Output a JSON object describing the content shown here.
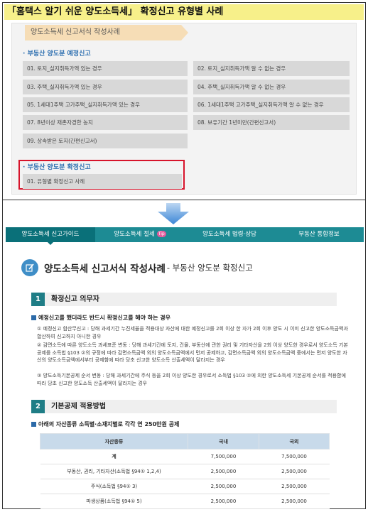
{
  "title": "「홈택스 알기 쉬운 양도소득세」 확정신고 유형별 사례",
  "top_panel": {
    "ribbon": "양도소득세 신고서식 작성사례",
    "section1_label": "부동산 양도분 예정신고",
    "items": [
      "01. 토지_실지취득가액 있는 경우",
      "02. 토지_실지취득가액 알 수 없는 경우",
      "03. 주택_실지취득가액 있는 경우",
      "04. 주택_실지취득가액 알 수 없는 경우",
      "05. 1세대1주택 고가주택_실지취득가액 있는 경우",
      "06. 1세대1주택 고가주택_실지취득가액 알 수 없는 경우",
      "07. 8년이상 재촌자경한 농지",
      "08. 보유기간 1년미만(간편신고서)",
      "09. 상속받은 토지(간편신고서)"
    ],
    "section2_label": "부동산 양도분 확정신고",
    "highlight_item": "01. 유형별 확정신고 사례"
  },
  "nav": {
    "items": [
      "양도소득세 신고가이드",
      "양도소득세 절세",
      "양도소득세 법령·상담",
      "부동산 통합정보"
    ],
    "tip_badge": "Tip"
  },
  "page": {
    "title": "양도소득세 신고서식 작성사례",
    "subtitle": "- 부동산 양도분 확정신고"
  },
  "step1": {
    "number": "1",
    "label": "확정신고 의무자",
    "bullet": "예정신고를 했더라도 반드시 확정신고를 해야 하는 경우",
    "para1": "① 예정신고 합산무신고 : 당해 과세기간 누진세율을 적용대상 자산에 대한 예정신고를 2회 이상 한 자가 2회 이후 양도 시 이미 신고한 양도소득금액과 합산하여 신고하지 아니한 경우",
    "para2": "② 감면소득에 따른 양도소득 과세표준 변동 : 당해 과세기간에 토지, 건물, 부동산에 관한 권리 및 기타자산을 2회 이상 양도한 경우로서 양도소득 기본공제를 소득법 §103 ②의 규정에 따라 감면소득금액 외의 양도소득금액에서 먼저 공제하고, 감면소득금액 외의 양도소득금액 중에서는 먼저 양도한 자산의 양도소득금액에서부터 공제함에 따라 당초 신고한 양도소득 산출세액이 달라지는 경우",
    "para3": "③ 양도소득기본공제 순서 변동 : 당해 과세기간에 주식 등을 2회 이상 양도한 경우로서 소득법 §103 ②에 의한 양도소득세 기본공제 순서를 적용함에 따라 당초 신고한 양도소득 산출세액이 달라지는 경우"
  },
  "step2": {
    "number": "2",
    "label": "기본공제 적용방법",
    "bullet": "아래의 자산종류 소득별·소재지별로 각각 연 250만원 공제"
  },
  "table": {
    "headers": [
      "자산종류",
      "국내",
      "국외"
    ],
    "rows": [
      [
        "계",
        "7,500,000",
        "7,500,000"
      ],
      [
        "부동산, 권리, 기타자산(소득법 §94① 1,2,4)",
        "2,500,000",
        "2,500,000"
      ],
      [
        "주식(소득법 §94① 3)",
        "2,500,000",
        "2,500,000"
      ],
      [
        "파생상품(소득법 §94① 5)",
        "2,500,000",
        "2,500,000"
      ]
    ]
  }
}
